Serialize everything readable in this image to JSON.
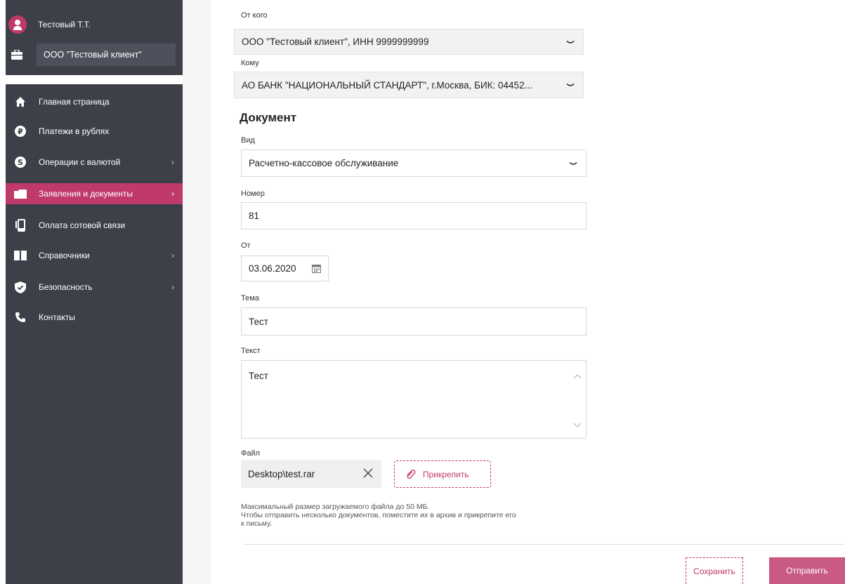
{
  "user": {
    "name": "Тестовый Т.Т.",
    "org": "ООО \"Тестовый клиент\""
  },
  "nav": [
    {
      "label": "Главная страница",
      "icon": "home-icon",
      "chevron": false,
      "active": false
    },
    {
      "label": "Платежи в рублях",
      "icon": "ruble-icon",
      "chevron": false,
      "active": false
    },
    {
      "label": "Операции с валютой",
      "icon": "dollar-icon",
      "chevron": true,
      "active": false
    },
    {
      "label": "Заявления и документы",
      "icon": "folder-icon",
      "chevron": true,
      "active": true
    },
    {
      "label": "Оплата сотовой связи",
      "icon": "mobile-icon",
      "chevron": false,
      "active": false
    },
    {
      "label": "Справочники",
      "icon": "book-icon",
      "chevron": true,
      "active": false
    },
    {
      "label": "Безопасность",
      "icon": "shield-icon",
      "chevron": true,
      "active": false
    },
    {
      "label": "Контакты",
      "icon": "phone-icon",
      "chevron": false,
      "active": false
    }
  ],
  "form": {
    "from_label": "От кого",
    "from_value": "ООО \"Тестовый клиент\", ИНН 9999999999",
    "to_label": "Кому",
    "to_value": "АО БАНК \"НАЦИОНАЛЬНЫЙ СТАНДАРТ\", г.Москва, БИК: 04452...",
    "section_title": "Документ",
    "type_label": "Вид",
    "type_value": "Расчетно-кассовое обслуживание",
    "number_label": "Номер",
    "number_value": "81",
    "date_label": "От",
    "date_value": "03.06.2020",
    "subject_label": "Тема",
    "subject_value": "Тест",
    "text_label": "Текст",
    "text_value": "Тест",
    "file_label": "Файл",
    "file_value": "Desktop\\test.rar",
    "attach_label": "Прикрепить",
    "note_line1": "Максимальный размер загружаемого файла до 50 МБ.",
    "note_line2": "Чтобы отправить несколько документов, поместите их в архив и прикрепите его",
    "note_line3": "к письму."
  },
  "actions": {
    "save": "Сохранить",
    "send": "Отправить"
  },
  "colors": {
    "accent": "#c0396b",
    "sidebar": "#3d4049",
    "send_button": "#c85a84"
  }
}
